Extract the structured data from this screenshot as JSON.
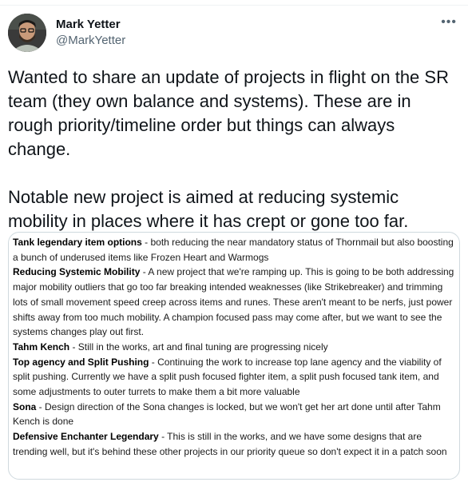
{
  "author": {
    "name": "Mark Yetter",
    "handle": "@MarkYetter",
    "more_icon": "more-horizontal-icon"
  },
  "tweet": {
    "paragraph_1": "Wanted to share an update of projects in flight on the SR team (they own balance and systems). These are in rough priority/timeline order but things can always change.",
    "paragraph_2": "Notable new project is aimed at reducing systemic mobility in places where it has crept or gone too far."
  },
  "notes": [
    {
      "title": "Tank legendary item options",
      "body": " - both reducing the near mandatory status of Thornmail but also boosting a bunch of underused items like Frozen Heart and Warmogs"
    },
    {
      "title": "Reducing Systemic Mobility",
      "body": " - A new project that we're ramping up. This is going to be both addressing major mobility outliers that go too far breaking intended weaknesses (like Strikebreaker) and trimming lots of small movement speed creep across items and runes. These aren't meant to be nerfs, just power shifts away from too much mobility. A champion focused pass may come after, but we want to see the systems changes play out first."
    },
    {
      "title": "Tahm Kench",
      "body": " - Still in the works, art and final tuning are progressing nicely"
    },
    {
      "title": "Top agency and Split Pushing",
      "body": " - Continuing the work to increase top lane agency and the viability of split pushing. Currently we have a split push focused fighter item, a split push focused tank item, and some adjustments to outer turrets to make them a bit more valuable"
    },
    {
      "title": "Sona",
      "body": " - Design direction of the Sona changes is locked, but we won't get her art done until after Tahm Kench is done"
    },
    {
      "title": "Defensive Enchanter Legendary",
      "body": " - This is still in the works, and we have some designs that are trending well, but it's behind these other projects in our priority queue so don't expect it in a patch soon"
    }
  ]
}
